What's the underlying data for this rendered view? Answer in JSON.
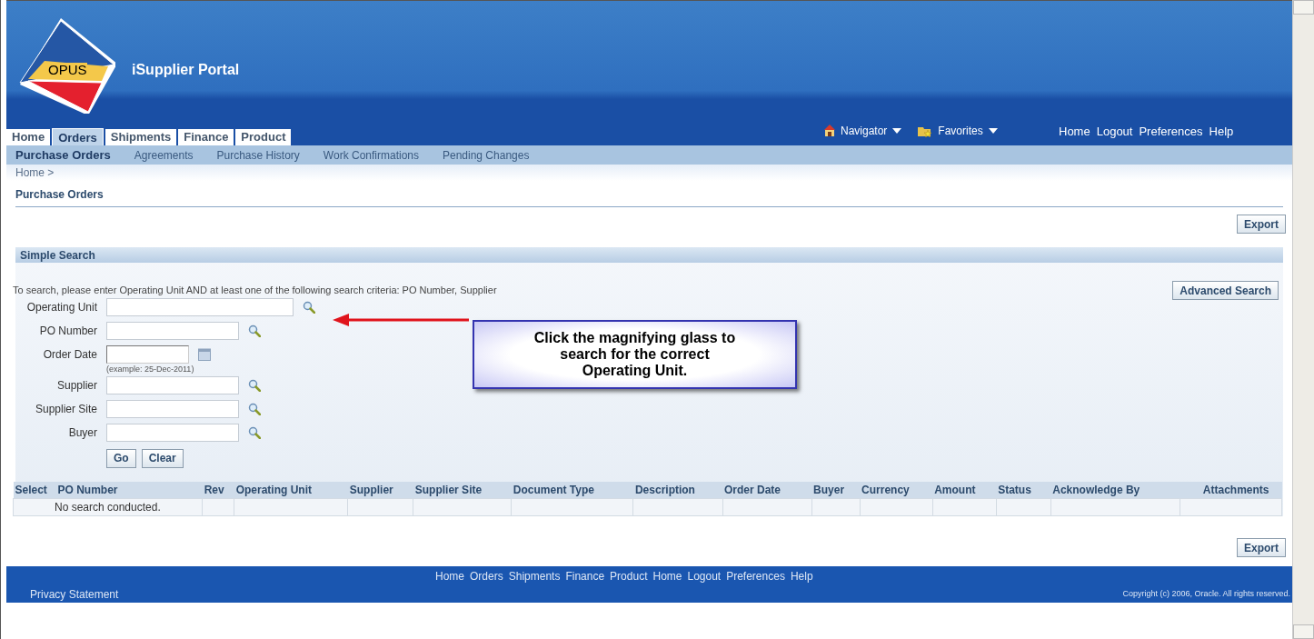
{
  "header": {
    "logo_text": "OPUS",
    "app_title": "iSupplier Portal",
    "global_menus": [
      {
        "label": "Navigator"
      },
      {
        "label": "Favorites"
      }
    ],
    "global_links": [
      "Home",
      "Logout",
      "Preferences",
      "Help"
    ]
  },
  "tabs": [
    {
      "label": "Home",
      "selected": false
    },
    {
      "label": "Orders",
      "selected": true
    },
    {
      "label": "Shipments",
      "selected": false
    },
    {
      "label": "Finance",
      "selected": false
    },
    {
      "label": "Product",
      "selected": false
    }
  ],
  "subtabs": [
    {
      "label": "Purchase Orders",
      "selected": true
    },
    {
      "label": "Agreements",
      "selected": false
    },
    {
      "label": "Purchase History",
      "selected": false
    },
    {
      "label": "Work Confirmations",
      "selected": false
    },
    {
      "label": "Pending Changes",
      "selected": false
    }
  ],
  "breadcrumb": "Home >",
  "page_title": "Purchase Orders",
  "export_button": "Export",
  "simple_search": {
    "title": "Simple Search",
    "instruction": "To search, please enter Operating Unit AND at least one of the following search criteria: PO Number, Supplier",
    "advanced_button": "Advanced Search",
    "fields": [
      {
        "label": "Operating Unit",
        "kind": "lov",
        "wide": true
      },
      {
        "label": "PO Number",
        "kind": "lov",
        "wide": false
      },
      {
        "label": "Order Date",
        "kind": "date",
        "hint": "(example: 25-Dec-2011)"
      },
      {
        "label": "Supplier",
        "kind": "lov",
        "wide": false
      },
      {
        "label": "Supplier Site",
        "kind": "lov",
        "wide": false
      },
      {
        "label": "Buyer",
        "kind": "lov",
        "wide": false
      }
    ],
    "buttons": [
      "Go",
      "Clear"
    ]
  },
  "table": {
    "columns": [
      "Select",
      "PO Number",
      "Rev",
      "Operating Unit",
      "Supplier",
      "Supplier Site",
      "Document Type",
      "Description",
      "Order Date",
      "Buyer",
      "Currency",
      "Amount",
      "Status",
      "Acknowledge By",
      "Attachments"
    ],
    "empty_message": "No search conducted."
  },
  "export_button_bottom": "Export",
  "footer": {
    "links": [
      "Home",
      "Orders",
      "Shipments",
      "Finance",
      "Product",
      "Home",
      "Logout",
      "Preferences",
      "Help"
    ],
    "privacy": "Privacy Statement",
    "copyright": "Copyright (c) 2006, Oracle. All rights reserved."
  },
  "callout": {
    "text": "Click the magnifying glass to search for the correct Operating Unit."
  }
}
